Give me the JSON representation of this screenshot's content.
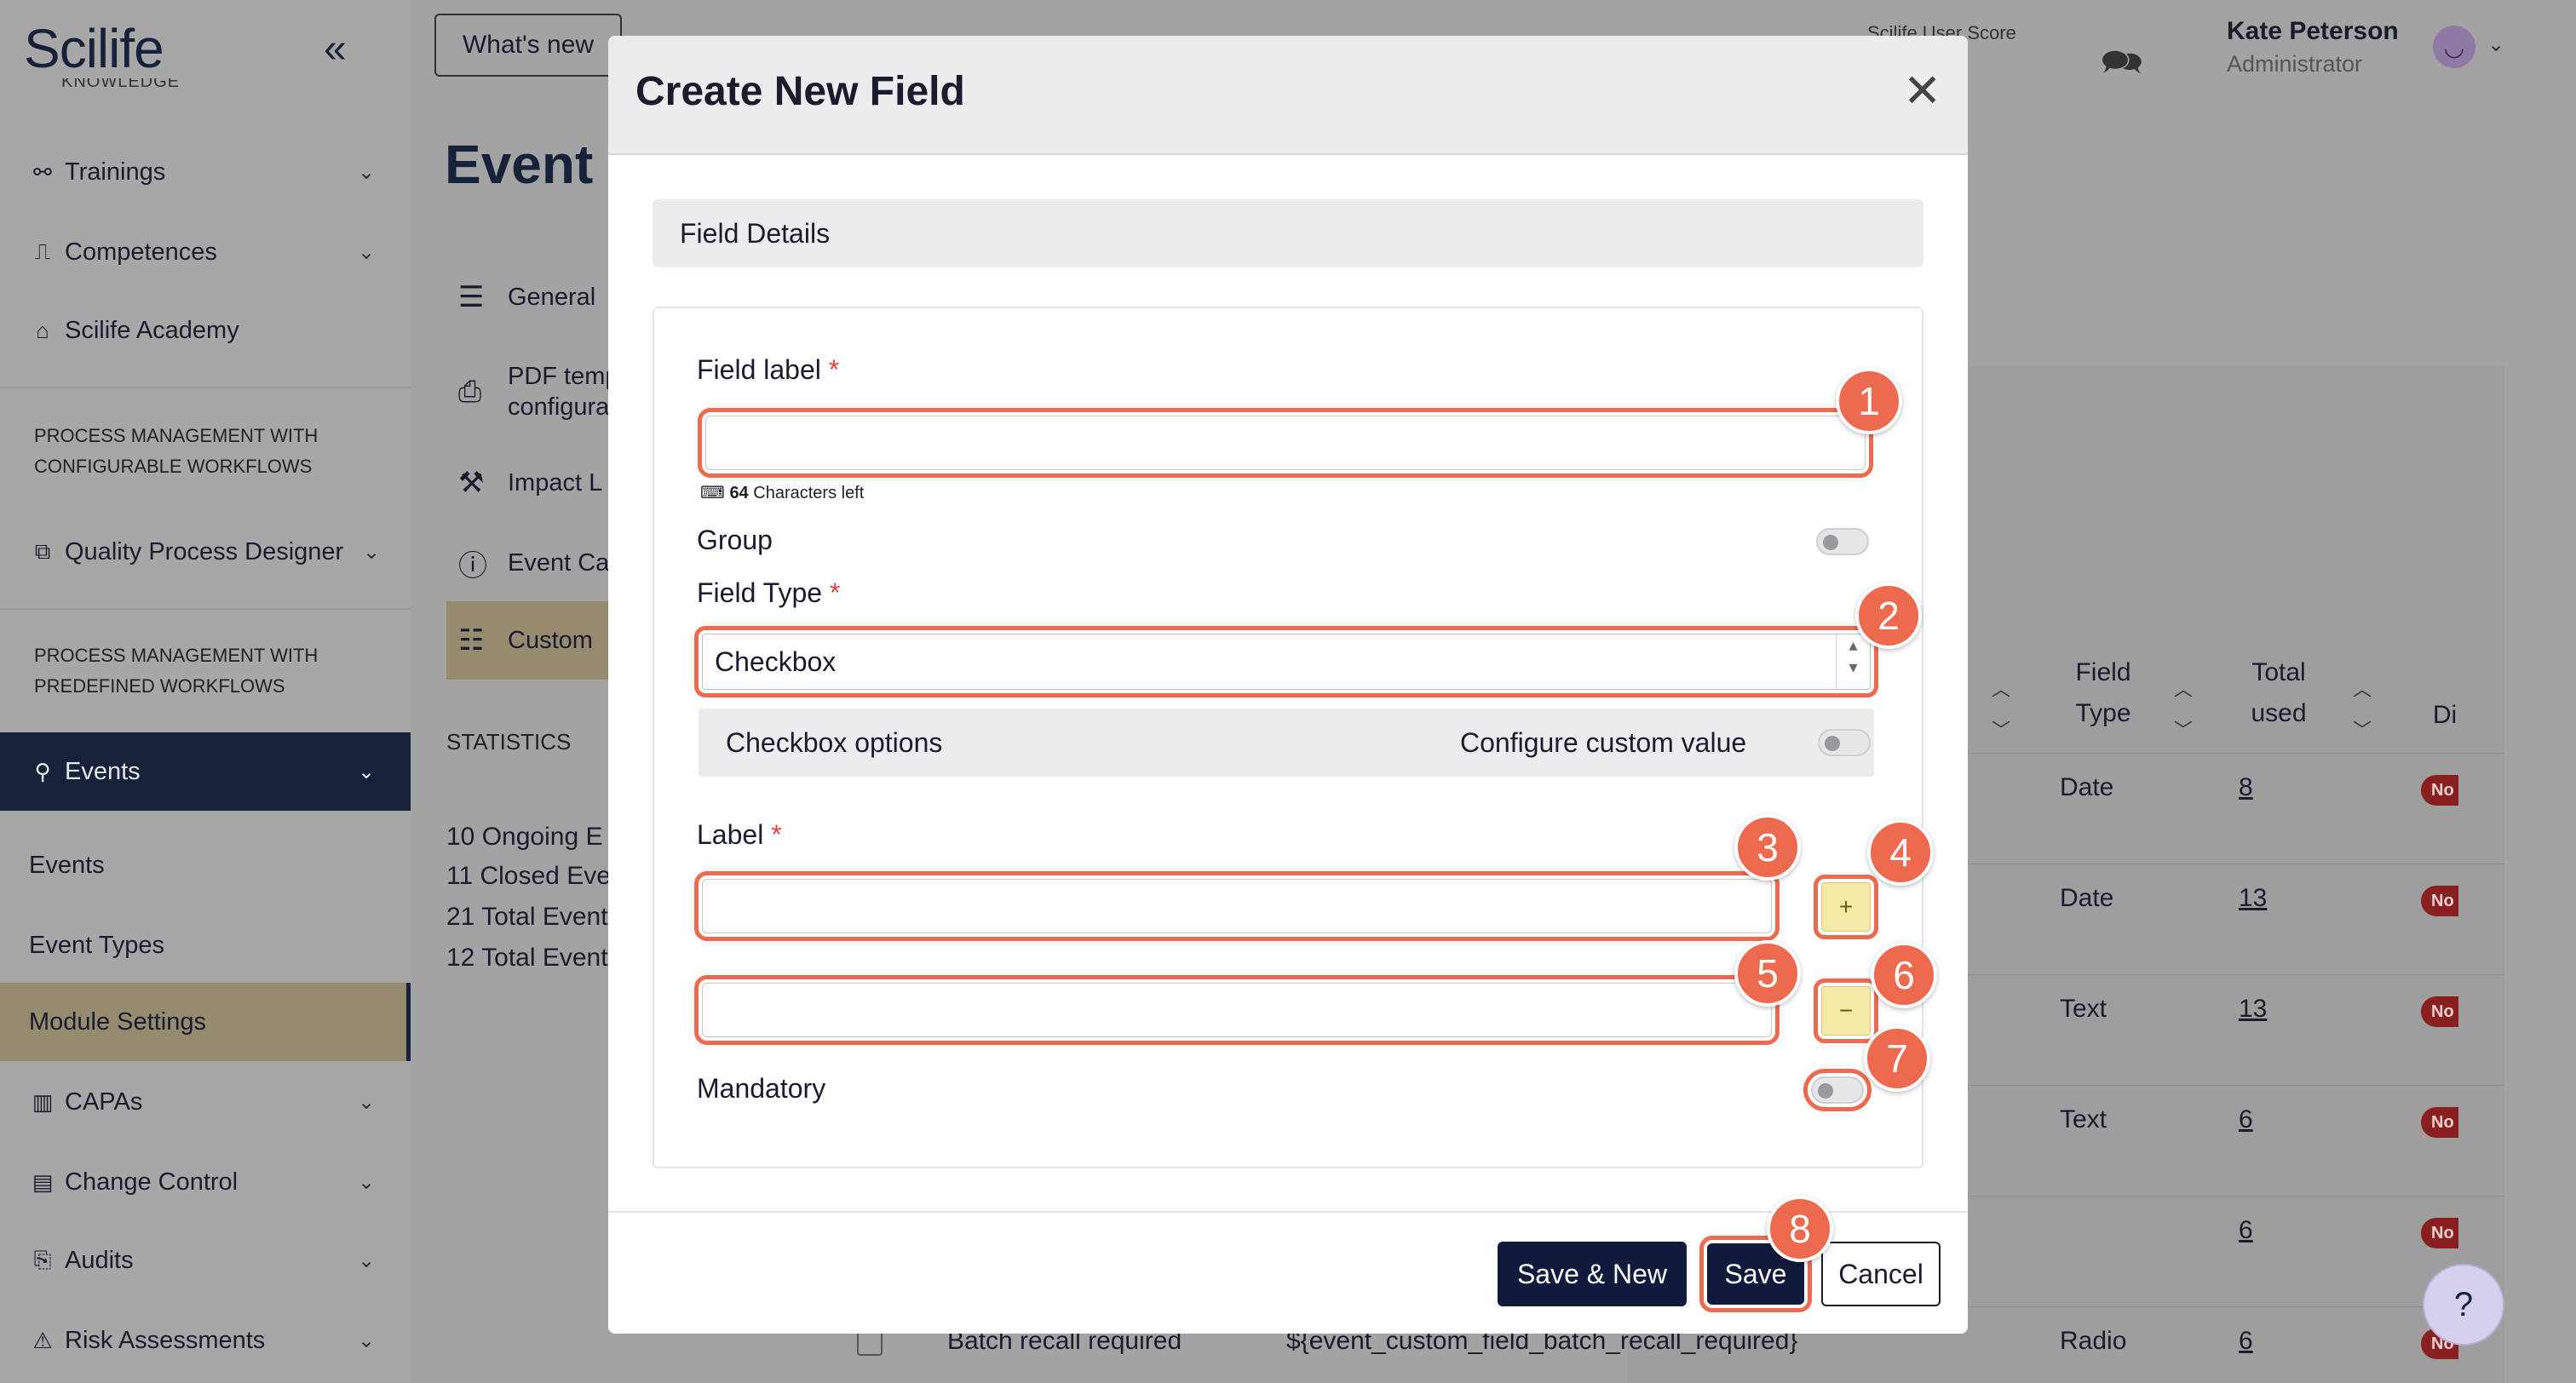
{
  "app": {
    "logo": "Scilife",
    "whats_new": "What's new",
    "user_score_label": "Scilife User Score",
    "user_name": "Kate Peterson",
    "user_role": "Administrator"
  },
  "sidebar": {
    "knowledge_label": "KNOWLEDGE",
    "items_top": [
      {
        "label": "Trainings",
        "icon": "handshake-icon"
      },
      {
        "label": "Competences",
        "icon": "chart-icon"
      },
      {
        "label": "Scilife Academy",
        "icon": "graduation-cap-icon"
      }
    ],
    "section_configurable": "PROCESS MANAGEMENT WITH CONFIGURABLE WORKFLOWS",
    "quality_process_designer": "Quality Process Designer",
    "section_predefined": "PROCESS MANAGEMENT WITH PREDEFINED WORKFLOWS",
    "events": "Events",
    "sub_events": "Events",
    "sub_event_types": "Event Types",
    "sub_module_settings": "Module Settings",
    "items_bottom": [
      {
        "label": "CAPAs"
      },
      {
        "label": "Change Control"
      },
      {
        "label": "Audits"
      },
      {
        "label": "Risk Assessments"
      }
    ]
  },
  "page": {
    "title": "Event",
    "nav": [
      "General",
      "PDF temp configura",
      "Impact L",
      "Event Ca",
      "Custom"
    ],
    "stats_title": "STATISTICS",
    "stats": [
      "10 Ongoing E",
      "11 Closed Eve",
      "21 Total Event",
      "12 Total Event"
    ]
  },
  "table": {
    "col_field_type": [
      "Field",
      "Type"
    ],
    "col_total_used": [
      "Total",
      "used"
    ],
    "col_di": "Di",
    "rows": [
      {
        "type": "Date",
        "used": "8",
        "badge": "No"
      },
      {
        "type": "Date",
        "used": "13",
        "badge": "No"
      },
      {
        "type": "Text",
        "used": "13",
        "badge": "No"
      },
      {
        "type": "Text",
        "used": "6",
        "badge": "No"
      },
      {
        "type": "",
        "used": "6",
        "badge": "No"
      },
      {
        "type": "Radio",
        "used": "6",
        "badge": "No"
      }
    ],
    "last_row_label": "Batch recall required",
    "last_row_key": "${event_custom_field_batch_recall_required}"
  },
  "modal": {
    "title": "Create New Field",
    "section": "Field Details",
    "field_label": "Field label",
    "field_label_value": "",
    "chars_left_count": "64",
    "chars_left_text": "Characters left",
    "group_label": "Group",
    "field_type_label": "Field Type",
    "field_type_value": "Checkbox",
    "checkbox_options": "Checkbox options",
    "configure_custom_value": "Configure custom value",
    "label": "Label",
    "label_value_1": "",
    "label_value_2": "",
    "add_symbol": "+",
    "remove_symbol": "−",
    "mandatory": "Mandatory",
    "save_new": "Save & New",
    "save": "Save",
    "cancel": "Cancel"
  },
  "badges": [
    "1",
    "2",
    "3",
    "4",
    "5",
    "6",
    "7",
    "8"
  ],
  "colors": {
    "navy": "#16213a",
    "accent_gold": "#958b6e",
    "highlight": "#ee6a4e",
    "primary_button": "#0f1a3d",
    "danger_pill": "#8a1f1f"
  }
}
